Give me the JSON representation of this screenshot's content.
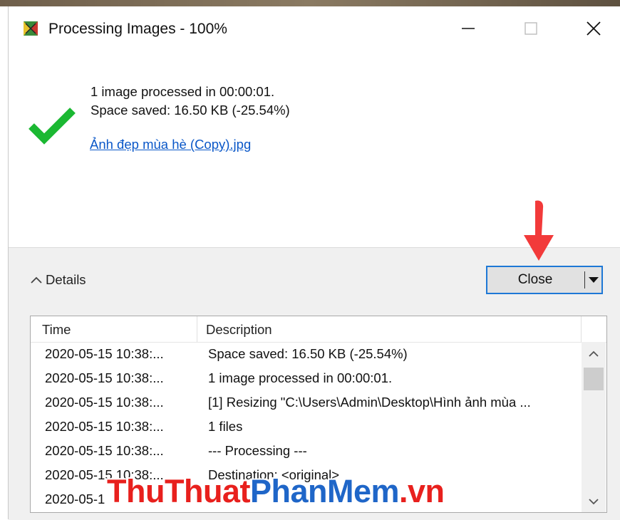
{
  "window": {
    "title": "Processing Images - 100%"
  },
  "summary": {
    "line1": "1 image processed in 00:00:01.",
    "line2": "Space saved: 16.50 KB (-25.54%)",
    "file_link": "Ảnh đẹp mùa hè (Copy).jpg"
  },
  "details": {
    "toggle_label": "Details",
    "close_label": "Close"
  },
  "log": {
    "columns": [
      "Time",
      "Description"
    ],
    "rows": [
      {
        "time": "2020-05-15 10:38:...",
        "desc": "Space saved: 16.50 KB (-25.54%)"
      },
      {
        "time": "2020-05-15 10:38:...",
        "desc": "1 image processed in 00:00:01."
      },
      {
        "time": "2020-05-15 10:38:...",
        "desc": "[1] Resizing \"C:\\Users\\Admin\\Desktop\\Hình ảnh mùa ..."
      },
      {
        "time": "2020-05-15 10:38:...",
        "desc": "1 files"
      },
      {
        "time": "2020-05-15 10:38:...",
        "desc": "--- Processing ---"
      },
      {
        "time": "2020-05-15 10:38:...",
        "desc": "Destination: <original>"
      },
      {
        "time": "2020-05-1",
        "desc": ""
      }
    ]
  },
  "watermark": {
    "part1": "ThuThuat",
    "part2": "PhanMem",
    "part3": ".vn"
  },
  "colors": {
    "accent": "#1e78d6",
    "check": "#1bb832",
    "link": "#0a57c8",
    "annotation_arrow": "#f23a3a"
  },
  "icons": [
    "app-icon",
    "minimize-icon",
    "maximize-icon",
    "close-icon",
    "checkmark-icon",
    "chevron-up-icon",
    "dropdown-arrow-icon",
    "scroll-up-icon",
    "scroll-down-icon",
    "annotation-arrow"
  ]
}
